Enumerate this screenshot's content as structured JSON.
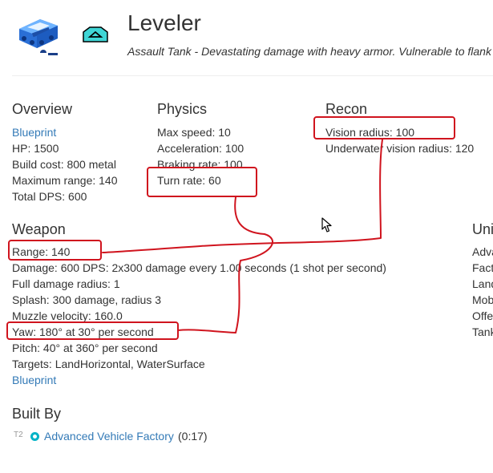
{
  "header": {
    "title": "Leveler",
    "subtitle": "Assault Tank - Devastating damage with heavy armor. Vulnerable to flank"
  },
  "overview": {
    "heading": "Overview",
    "blueprint": "Blueprint",
    "hp": "HP: 1500",
    "build_cost": "Build cost: 800 metal",
    "max_range": "Maximum range: 140",
    "total_dps": "Total DPS: 600"
  },
  "physics": {
    "heading": "Physics",
    "max_speed": "Max speed: 10",
    "acceleration": "Acceleration: 100",
    "braking": "Braking rate: 100",
    "turn_rate": "Turn rate: 60"
  },
  "recon": {
    "heading": "Recon",
    "vision": "Vision radius: 100",
    "underwater": "Underwater vision radius: 120"
  },
  "weapon": {
    "heading": "Weapon",
    "range": "Range: 140",
    "damage": "Damage: 600 DPS: 2x300 damage every 1.00 seconds (1 shot per second)",
    "full_damage": "Full damage radius: 1",
    "splash": "Splash: 300 damage, radius 3",
    "muzzle": "Muzzle velocity: 160.0",
    "yaw": "Yaw: 180° at 30° per second",
    "pitch": "Pitch: 40° at 360° per second",
    "targets": "Targets: LandHorizontal, WaterSurface",
    "blueprint": "Blueprint"
  },
  "unit_types": {
    "heading": "Uni",
    "items": [
      "Adva",
      "Fact",
      "Land",
      "Mob",
      "Offe",
      "Tank"
    ]
  },
  "built_by": {
    "heading": "Built By",
    "tier": "T2",
    "factory": "Advanced Vehicle Factory",
    "time": "(0:17)"
  },
  "colors": {
    "link": "#337ab7",
    "annotation": "#d0141e",
    "factory_icon": "#00b3c7"
  }
}
